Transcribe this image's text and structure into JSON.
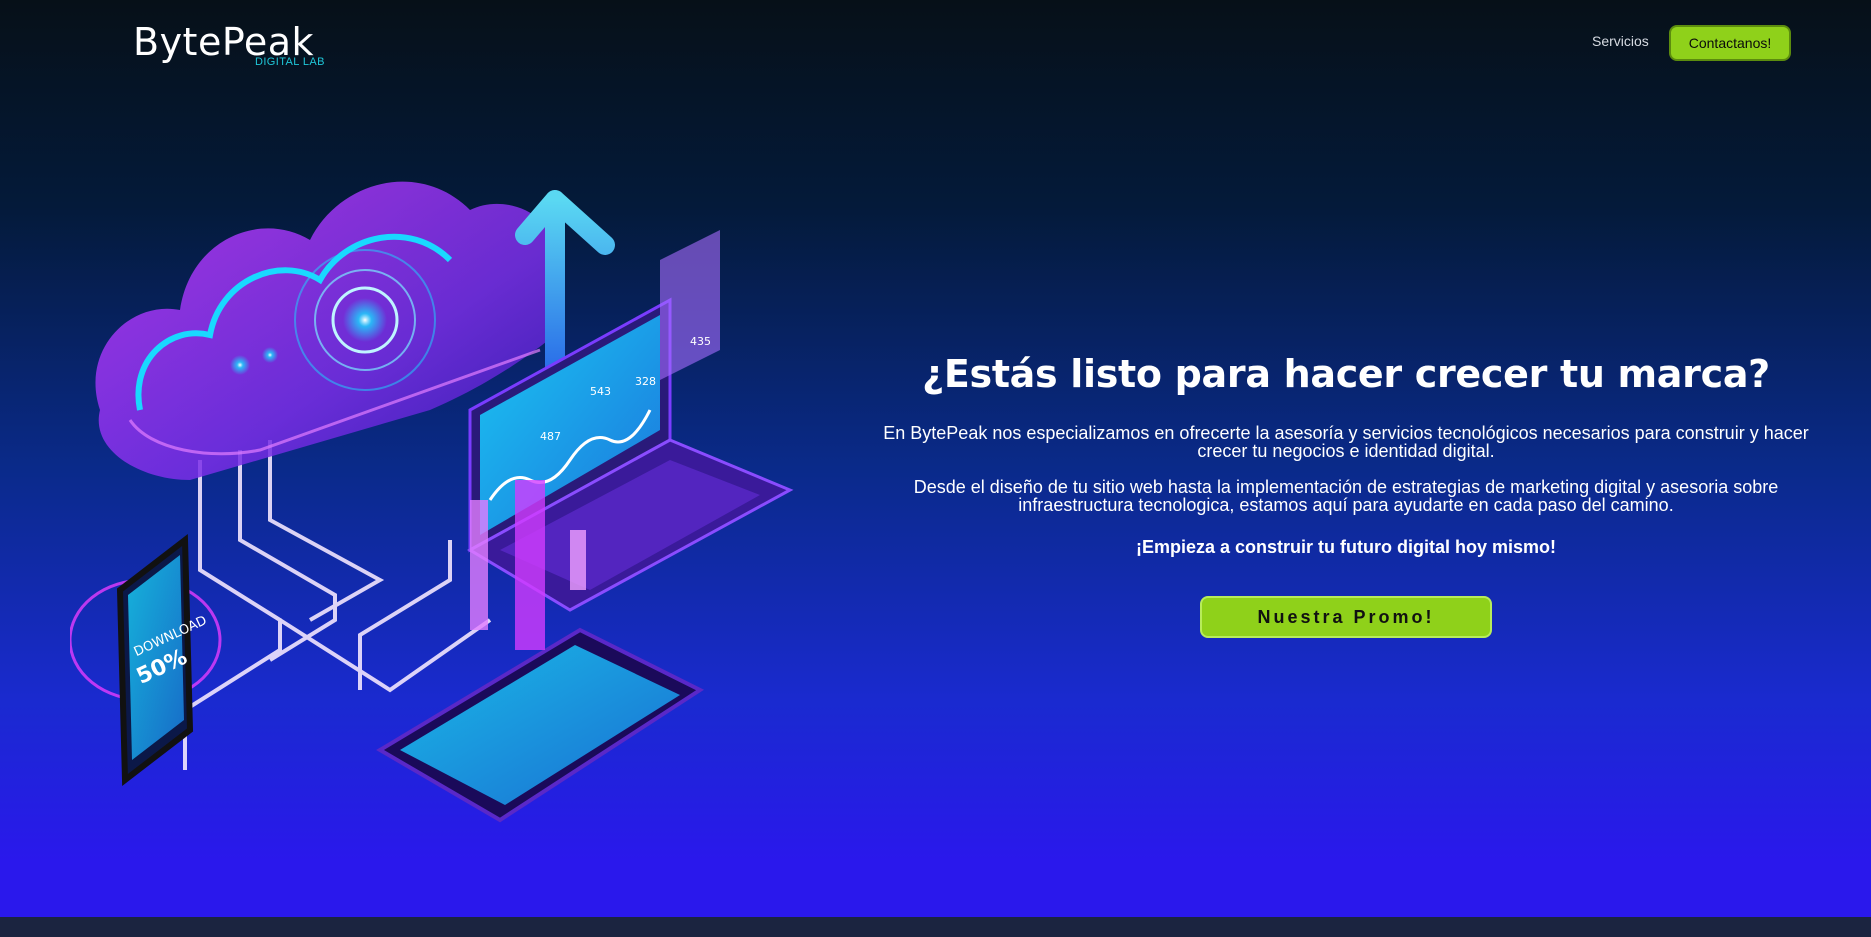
{
  "header": {
    "logo": {
      "main": "BytePeak",
      "sub": "DIGITAL LAB"
    },
    "nav": {
      "services": "Servicios",
      "contact": "Contactanos!"
    }
  },
  "hero": {
    "title": "¿Estás listo para hacer crecer tu marca?",
    "paragraph1": "En BytePeak nos especializamos en ofrecerte la asesoría y servicios tecnológicos necesarios para construir y hacer crecer tu negocios e identidad digital.",
    "paragraph2": "Desde el diseño de tu sitio web hasta la implementación de estrategias de marketing digital y asesoria sobre infraestructura tecnologica, estamos aquí para ayudarte en cada paso del camino.",
    "cta_text": "¡Empieza a construir tu futuro digital hoy mismo!",
    "promo_button": "Nuestra Promo!"
  },
  "illustration": {
    "chart_labels": [
      "487",
      "543",
      "328",
      "435"
    ],
    "phone_text_1": "DOWNLOAD",
    "phone_text_2": "50%"
  },
  "colors": {
    "accent_green": "#8fd11a",
    "logo_teal": "#1fc6d8",
    "neon_cyan": "#19d9ff",
    "neon_magenta": "#d23cff"
  }
}
